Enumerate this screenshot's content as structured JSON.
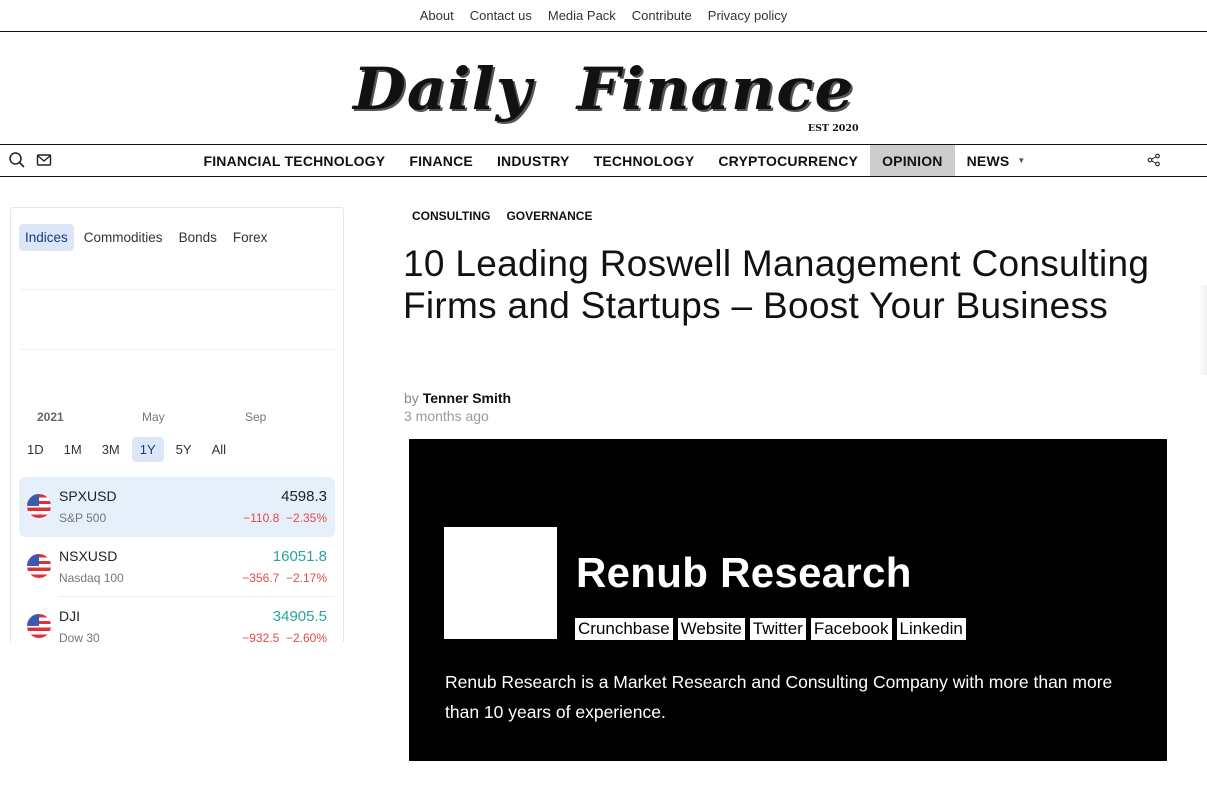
{
  "top_links": [
    "About",
    "Contact us",
    "Media Pack",
    "Contribute",
    "Privacy policy"
  ],
  "logo": {
    "text": "Daily  Finance",
    "est": "EST 2020"
  },
  "nav": {
    "items": [
      {
        "label": "FINANCIAL TECHNOLOGY"
      },
      {
        "label": "FINANCE"
      },
      {
        "label": "INDUSTRY"
      },
      {
        "label": "TECHNOLOGY"
      },
      {
        "label": "CRYPTOCURRENCY"
      },
      {
        "label": "OPINION",
        "active": true
      },
      {
        "label": "NEWS",
        "dropdown": true
      }
    ],
    "icons": [
      "search-icon",
      "mail-icon",
      "share-icon"
    ]
  },
  "widget": {
    "tabs": [
      "Indices",
      "Commodities",
      "Bonds",
      "Forex"
    ],
    "active_tab": "Indices",
    "axis_labels": [
      "2021",
      "May",
      "Sep"
    ],
    "ranges": [
      "1D",
      "1M",
      "3M",
      "1Y",
      "5Y",
      "All"
    ],
    "active_range": "1Y",
    "quotes": [
      {
        "symbol": "SPXUSD",
        "name": "S&P 500",
        "price": "4598.3",
        "change": "−110.8",
        "change_pct": "−2.35%",
        "price_color": "#222222"
      },
      {
        "symbol": "NSXUSD",
        "name": "Nasdaq 100",
        "price": "16051.8",
        "change": "−356.7",
        "change_pct": "−2.17%",
        "price_color": "#26a69a"
      },
      {
        "symbol": "DJI",
        "name": "Dow 30",
        "price": "34905.5",
        "change": "−932.5",
        "change_pct": "−2.60%",
        "price_color": "#26a69a"
      }
    ]
  },
  "article": {
    "categories": [
      "CONSULTING",
      "GOVERNANCE"
    ],
    "title": "10 Leading Roswell Management Consulting Firms and Startups – Boost Your Business",
    "by_prefix": "by",
    "author": "Tenner Smith",
    "time_ago": "3 months ago"
  },
  "company_card": {
    "name": "Renub Research",
    "links": [
      "Crunchbase",
      "Website",
      "Twitter",
      "Facebook",
      "Linkedin"
    ],
    "description": "Renub Research is a Market Research and Consulting Company with more than more than 10 years of experience."
  }
}
